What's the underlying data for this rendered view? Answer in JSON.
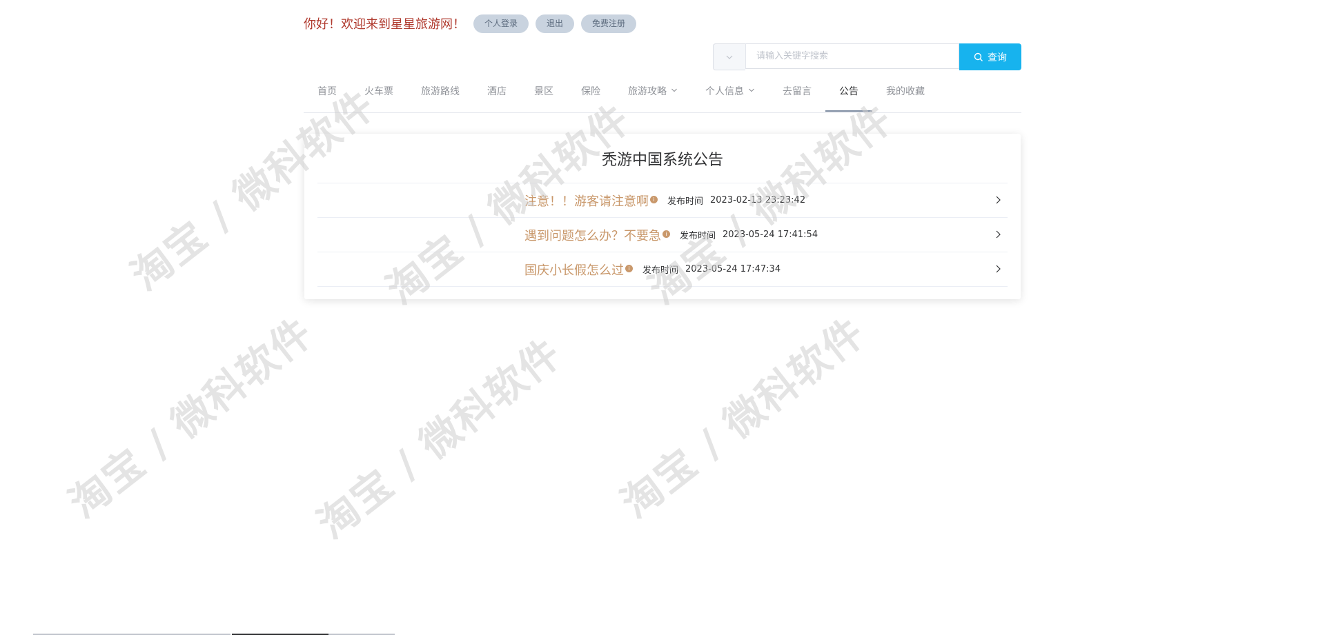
{
  "header": {
    "welcome": "你好！欢迎来到星星旅游网！",
    "buttons": [
      "个人登录",
      "退出",
      "免费注册"
    ]
  },
  "search": {
    "placeholder": "请输入关键字搜索",
    "button_label": "查询"
  },
  "nav": {
    "items": [
      {
        "label": "首页"
      },
      {
        "label": "火车票"
      },
      {
        "label": "旅游路线"
      },
      {
        "label": "酒店"
      },
      {
        "label": "景区"
      },
      {
        "label": "保险"
      },
      {
        "label": "旅游攻略"
      },
      {
        "label": "个人信息"
      },
      {
        "label": "去留言"
      },
      {
        "label": "公告"
      },
      {
        "label": "我的收藏"
      }
    ],
    "active": "公告"
  },
  "notice": {
    "title": "秃游中国系统公告",
    "time_label": "发布时间",
    "items": [
      {
        "title": "注意！！游客请注意啊",
        "time": "2023-02-13 23:23:42"
      },
      {
        "title": "遇到问题怎么办？不要急",
        "time": "2023-05-24 17:41:54"
      },
      {
        "title": "国庆小长假怎么过",
        "time": "2023-05-24 17:47:34"
      }
    ]
  },
  "watermark": "淘宝 / 微科软件",
  "colors": {
    "welcome_text": "#b03a2e",
    "search_button": "#17b3ee",
    "notice_title": "#c9986b",
    "active_tab_underline": "#7c8ba1"
  }
}
